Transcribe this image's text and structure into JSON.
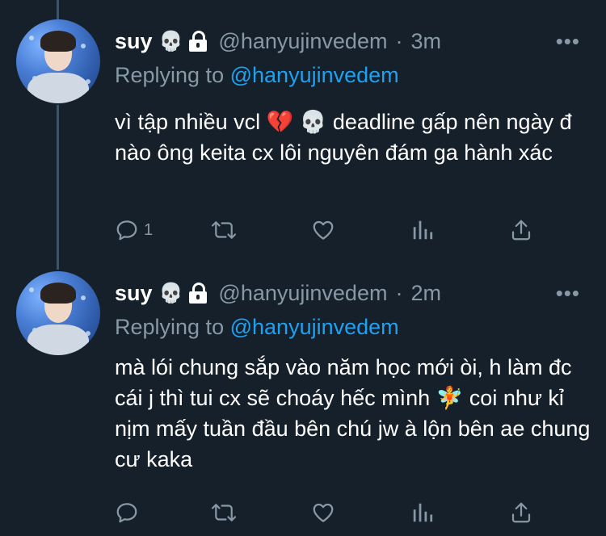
{
  "tweets": [
    {
      "name": "suy",
      "skull": "💀",
      "handle": "@hanyujinvedem",
      "sep": "·",
      "time": "3m",
      "more": "•••",
      "replying_prefix": "Replying to",
      "replying_handle": "@hanyujinvedem",
      "text": "vì tập nhiều vcl 💔 💀  deadline gấp nên ngày đ nào ông keita cx lôi nguyên đám ga hành xác",
      "reply_count": "1"
    },
    {
      "name": "suy",
      "skull": "💀",
      "handle": "@hanyujinvedem",
      "sep": "·",
      "time": "2m",
      "more": "•••",
      "replying_prefix": "Replying to",
      "replying_handle": "@hanyujinvedem",
      "text": "mà lói chung sắp vào năm học mới òi, h làm đc cái j thì tui cx sẽ choáy hếc mình 🧚  coi như kỉ nịm mấy tuần đầu bên chú jw à lộn bên ae chung cư kaka",
      "reply_count": ""
    }
  ],
  "icons": [
    "reply-icon",
    "retweet-icon",
    "like-icon",
    "analytics-icon",
    "share-icon",
    "lock-icon",
    "more-icon"
  ],
  "colors": {
    "background": "#15202b",
    "secondary_text": "#8899a6",
    "link": "#1da1f2",
    "thread_line": "#3d5466"
  }
}
